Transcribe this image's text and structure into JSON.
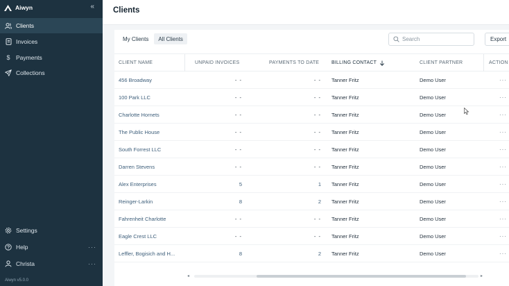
{
  "sidebar": {
    "brand": "Aiwyn",
    "collapse_icon": "double-chevron-left",
    "items": [
      {
        "label": "Clients",
        "icon": "users-icon",
        "active": true
      },
      {
        "label": "Invoices",
        "icon": "invoice-icon"
      },
      {
        "label": "Payments",
        "icon": "dollar-icon"
      },
      {
        "label": "Collections",
        "icon": "send-icon"
      }
    ],
    "bottom_items": [
      {
        "label": "Settings",
        "icon": "gear-icon"
      },
      {
        "label": "Help",
        "icon": "help-icon",
        "more": "···"
      },
      {
        "label": "Christa",
        "icon": "user-icon",
        "more": "···"
      }
    ],
    "version": "Aiwyn v5.0.0"
  },
  "header": {
    "title": "Clients"
  },
  "toolbar": {
    "tabs": [
      {
        "label": "My Clients",
        "selected": false
      },
      {
        "label": "All Clients",
        "selected": true
      }
    ],
    "search_placeholder": "Search",
    "export_label": "Export"
  },
  "table": {
    "columns": [
      {
        "label": "CLIENT NAME"
      },
      {
        "label": "UNPAID INVOICES"
      },
      {
        "label": "PAYMENTS TO DATE"
      },
      {
        "label": "BILLING CONTACT",
        "sorted": "desc"
      },
      {
        "label": "CLIENT PARTNER"
      },
      {
        "label": "ACTION"
      }
    ],
    "rows": [
      {
        "name": "456 Broadway",
        "unpaid": "- -",
        "payments": "- -",
        "contact": "Tanner Fritz",
        "partner": "Demo User",
        "action": "···"
      },
      {
        "name": "100 Park LLC",
        "unpaid": "- -",
        "payments": "- -",
        "contact": "Tanner Fritz",
        "partner": "Demo User",
        "action": "···"
      },
      {
        "name": "Charlotte Hornets",
        "unpaid": "- -",
        "payments": "- -",
        "contact": "Tanner Fritz",
        "partner": "Demo User",
        "action": "···"
      },
      {
        "name": "The Public House",
        "unpaid": "- -",
        "payments": "- -",
        "contact": "Tanner Fritz",
        "partner": "Demo User",
        "action": "···"
      },
      {
        "name": "South Forrest LLC",
        "unpaid": "- -",
        "payments": "- -",
        "contact": "Tanner Fritz",
        "partner": "Demo User",
        "action": "···"
      },
      {
        "name": "Darren Stevens",
        "unpaid": "- -",
        "payments": "- -",
        "contact": "Tanner Fritz",
        "partner": "Demo User",
        "action": "···"
      },
      {
        "name": "Alex Enterprises",
        "unpaid": "5",
        "payments": "1",
        "contact": "Tanner Fritz",
        "partner": "Demo User",
        "action": "···"
      },
      {
        "name": "Reinger-Larkin",
        "unpaid": "8",
        "payments": "2",
        "contact": "Tanner Fritz",
        "partner": "Demo User",
        "action": "···"
      },
      {
        "name": "Fahrenheit Charlotte",
        "unpaid": "- -",
        "payments": "- -",
        "contact": "Tanner Fritz",
        "partner": "Demo User",
        "action": "···"
      },
      {
        "name": "Eagle Crest LLC",
        "unpaid": "- -",
        "payments": "- -",
        "contact": "Tanner Fritz",
        "partner": "Demo User",
        "action": "···"
      },
      {
        "name": "Leffler, Bogisich and H...",
        "unpaid": "8",
        "payments": "2",
        "contact": "Tanner Fritz",
        "partner": "Demo User",
        "action": "···"
      }
    ]
  },
  "colors": {
    "sidebar_bg": "#1d3240",
    "sidebar_active": "#2b4656",
    "link": "#3d5e7a"
  }
}
